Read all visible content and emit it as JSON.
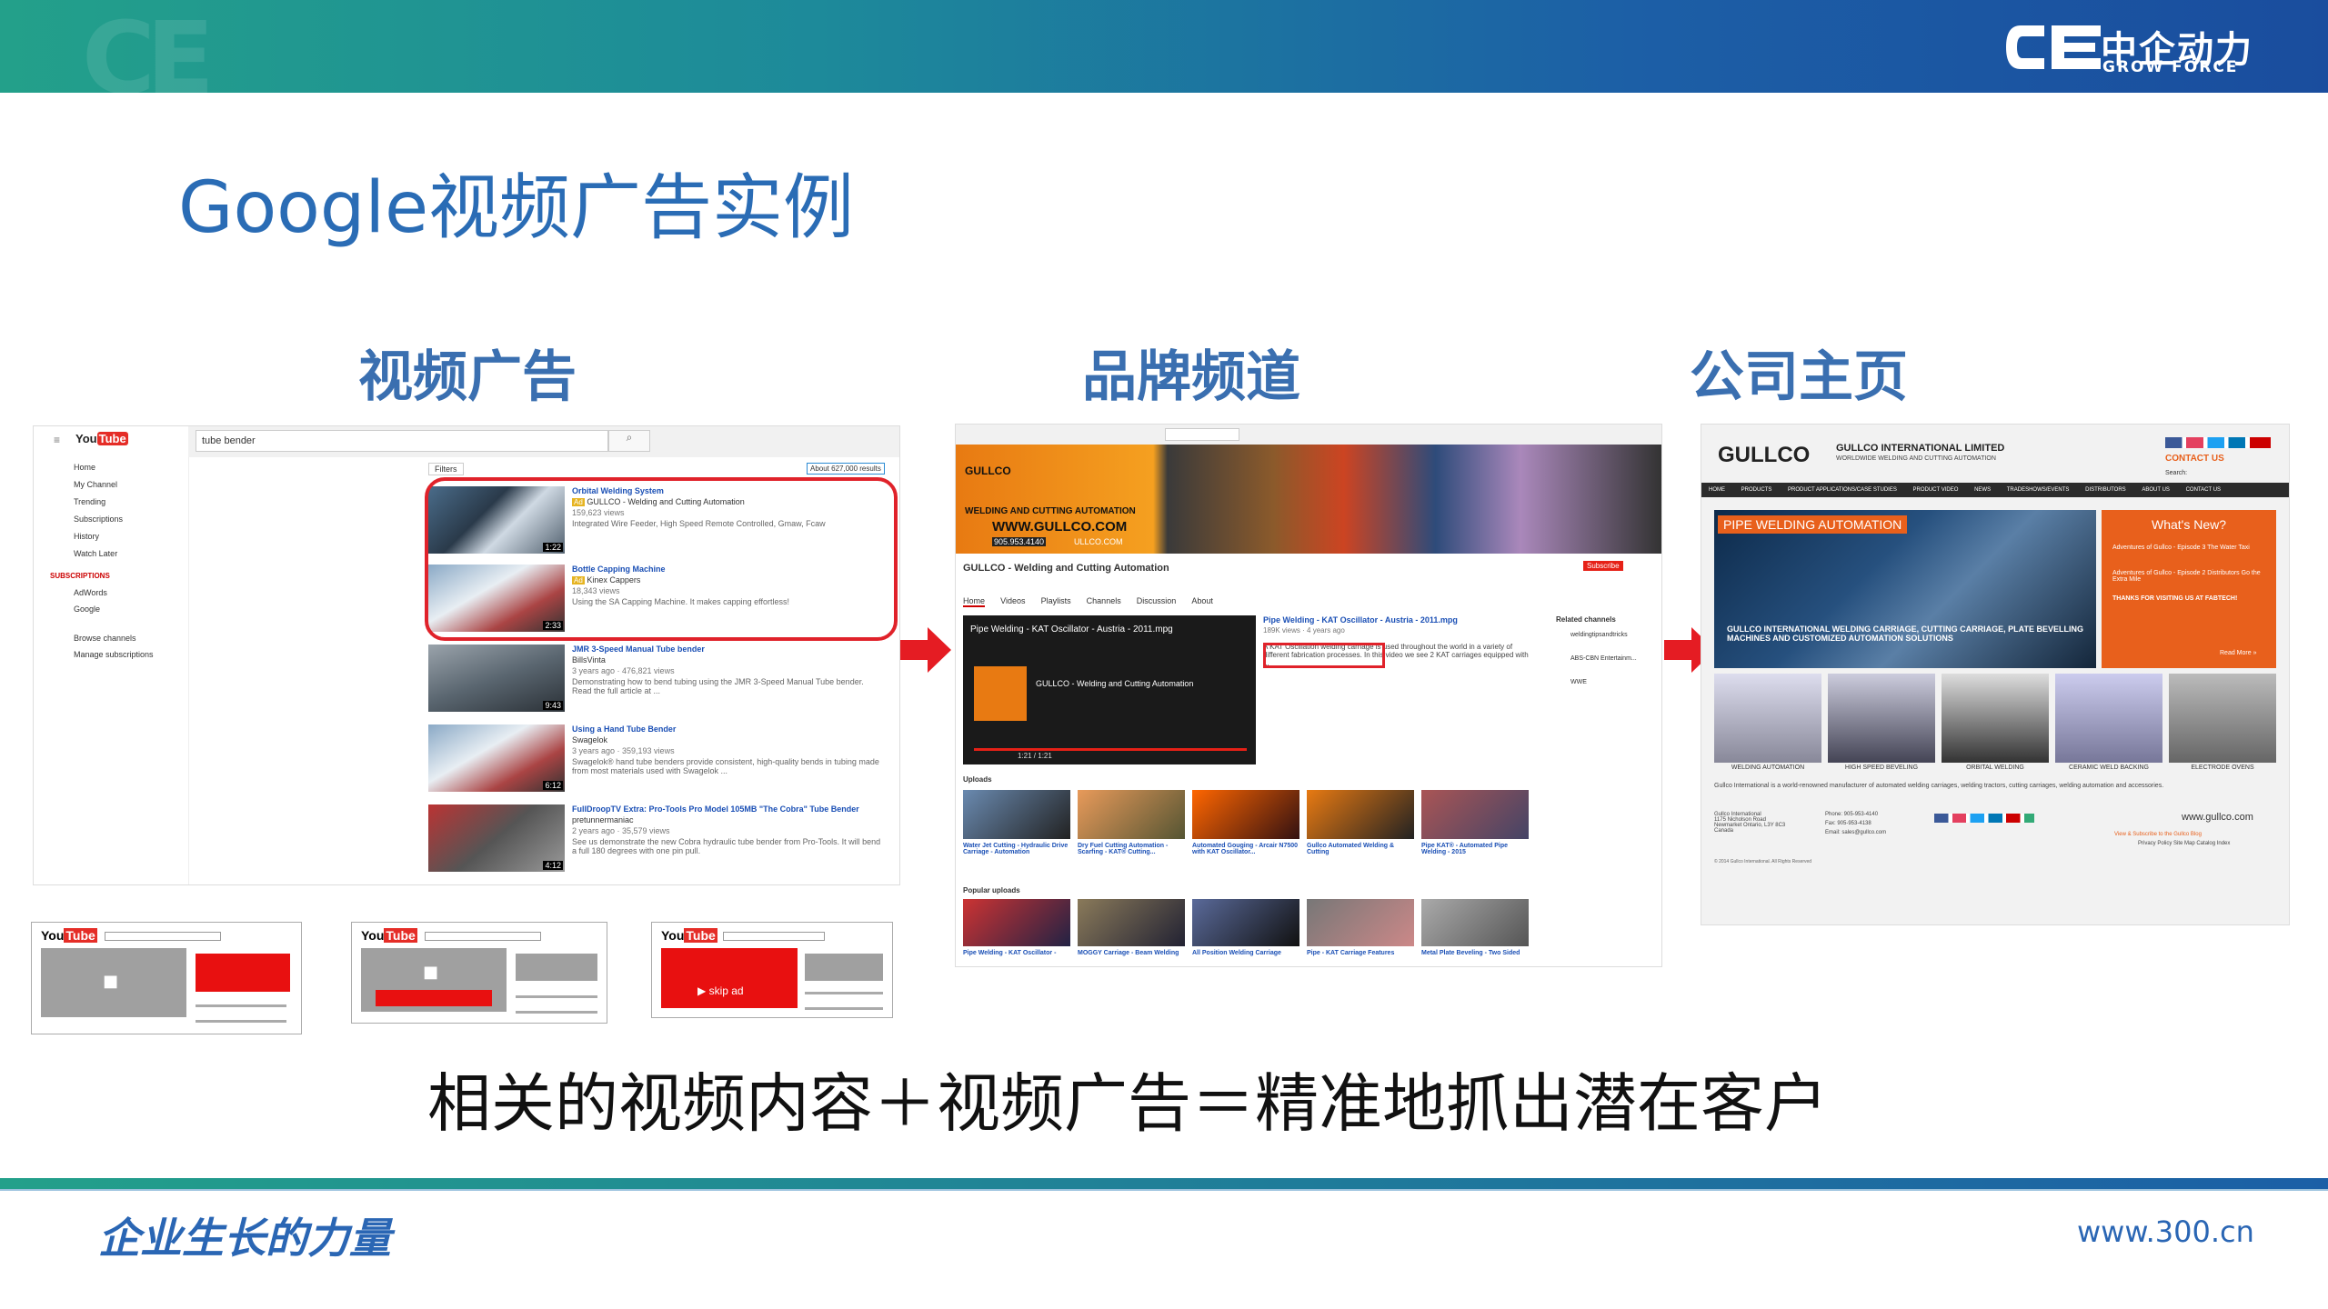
{
  "header": {
    "logo_cn": "中企动力",
    "logo_en": "GROW FORCE"
  },
  "title": "Google视频广告实例",
  "sections": [
    {
      "label": "视频广告"
    },
    {
      "label": "品牌频道"
    },
    {
      "label": "公司主页"
    }
  ],
  "caption": "相关的视频内容＋视频广告＝精准地抓出潜在客户",
  "footer": {
    "slogan": "企业生长的力量",
    "url": "www.300.cn"
  },
  "youtube_search": {
    "query": "tube bender",
    "filters": "Filters",
    "results": "About 627,000 results",
    "sidebar": [
      "Home",
      "My Channel",
      "Trending",
      "Subscriptions",
      "History",
      "Watch Later"
    ],
    "subscriptions_header": "SUBSCRIPTIONS",
    "subscriptions": [
      "AdWords",
      "Google"
    ],
    "sidebar_bottom": [
      "Browse channels",
      "Manage subscriptions"
    ],
    "videos": [
      {
        "title": "Orbital Welding System",
        "channel": "GULLCO - Welding and Cutting Automation",
        "views": "159,623 views",
        "desc": "Integrated Wire Feeder, High Speed Remote Controlled, Gmaw, Fcaw",
        "duration": "1:22",
        "ad": "Ad"
      },
      {
        "title": "Bottle Capping Machine",
        "channel": "Kinex Cappers",
        "views": "18,343 views",
        "desc": "Using the SA Capping Machine. It makes capping effortless!",
        "duration": "2:33",
        "ad": "Ad"
      },
      {
        "title": "JMR 3-Speed Manual Tube bender",
        "channel": "BillsVinta",
        "views": "3 years ago · 476,821 views",
        "desc": "Demonstrating how to bend tubing using the JMR 3-Speed Manual Tube bender. Read the full article at ...",
        "duration": "9:43"
      },
      {
        "title": "Using a Hand Tube Bender",
        "channel": "Swagelok",
        "views": "3 years ago · 359,193 views",
        "desc": "Swagelok® hand tube benders provide consistent, high-quality bends in tubing made from most materials used with Swagelok ...",
        "duration": "6:12"
      },
      {
        "title": "FullDroopTV Extra: Pro-Tools Pro Model 105MB \"The Cobra\" Tube Bender",
        "channel": "pretunnermaniac",
        "views": "2 years ago · 35,579 views",
        "desc": "See us demonstrate the new Cobra hydraulic tube bender from Pro-Tools. It will bend a full 180 degrees with one pin pull.",
        "duration": "4:12"
      }
    ]
  },
  "yt_mockups": [
    {
      "logo_you": "You",
      "logo_tube": "Tube"
    },
    {
      "logo_you": "You",
      "logo_tube": "Tube"
    },
    {
      "logo_you": "You",
      "logo_tube": "Tube",
      "skip": "▶ skip ad"
    }
  ],
  "brand_channel": {
    "banner_brand": "GULLCO",
    "banner_tag": "WELDING AND CUTTING AUTOMATION",
    "banner_url": "WWW.GULLCO.COM",
    "banner_phone": "905.953.4140",
    "banner_url2": "ULLCO.COM",
    "channel_name": "GULLCO - Welding and Cutting Automation",
    "subscribe": "Subscribe",
    "tabs": [
      "Home",
      "Videos",
      "Playlists",
      "Channels",
      "Discussion",
      "About"
    ],
    "featured_title": "Pipe Welding - KAT Oscillator - Austria - 2011.mpg",
    "featured_channel": "GULLCO - Welding and Cutting Automation",
    "featured_side_title": "Pipe Welding - KAT Oscillator - Austria - 2011.mpg",
    "featured_views": "189K views · 4 years ago",
    "featured_desc": "A KAT Oscillation welding carriage is used throughout the world in a variety of different fabrication processes. In this video we see 2 KAT carriages equipped with ...",
    "player_time": "1:21 / 1:21",
    "related_header": "Related channels",
    "related": [
      "weldingtipsandtricks",
      "ABS-CBN Entertainm...",
      "WWE"
    ],
    "uploads_header": "Uploads",
    "uploads": [
      "Water Jet Cutting - Hydraulic Drive Carriage - Automation",
      "Dry Fuel Cutting Automation - Scarfing - KAT® Cutting...",
      "Automated Gouging - Arcair N7500 with KAT Oscillator...",
      "Gullco Automated Welding & Cutting",
      "Pipe KAT® - Automated Pipe Welding - 2015"
    ],
    "popular_header": "Popular uploads",
    "popular": [
      "Pipe Welding - KAT Oscillator -",
      "MOGGY Carriage - Beam Welding",
      "All Position Welding Carriage",
      "Pipe - KAT Carriage Features",
      "Metal Plate Beveling - Two Sided"
    ]
  },
  "company_page": {
    "logo": "GULLCO",
    "company_name": "GULLCO INTERNATIONAL LIMITED",
    "company_sub": "WORLDWIDE WELDING AND CUTTING AUTOMATION",
    "contact": "CONTACT US",
    "search": "Search:",
    "nav": [
      "HOME",
      "PRODUCTS",
      "PRODUCT APPLICATIONS/CASE STUDIES",
      "PRODUCT VIDEO",
      "NEWS",
      "TRADESHOWS/EVENTS",
      "DISTRIBUTORS",
      "ABOUT US",
      "CONTACT US"
    ],
    "hero_badge": "PIPE WELDING AUTOMATION",
    "hero_caption": "GULLCO INTERNATIONAL WELDING CARRIAGE, CUTTING CARRIAGE, PLATE BEVELLING MACHINES AND CUSTOMIZED AUTOMATION SOLUTIONS",
    "whats_new": "What's New?",
    "news": [
      "Adventures of Gullco - Episode 3 The Water Taxi",
      "Adventures of Gullco - Episode 2 Distributors Go the Extra Mile",
      "THANKS FOR VISITING US AT FABTECH!"
    ],
    "read_more": "Read More »",
    "products": [
      "WELDING AUTOMATION",
      "HIGH SPEED BEVELING",
      "ORBITAL WELDING",
      "CERAMIC WELD BACKING",
      "ELECTRODE OVENS"
    ],
    "intro": "Gullco International is a world-renowned manufacturer of automated welding carriages, welding tractors, cutting carriages, welding automation and accessories.",
    "address": "Gullco International\n1175 Nicholson Road\nNewmarket Ontario, L3Y 8C3\nCanada",
    "phone": "Phone: 905-953-4140",
    "fax": "Fax: 905-953-4138",
    "email": "Email: sales@gullco.com",
    "website": "www.gullco.com",
    "blog": "View & Subscribe to the Gullco Blog",
    "links": "Privacy Policy   Site Map   Catalog Index",
    "copyright": "© 2014 Gullco International. All Rights Reserved"
  }
}
